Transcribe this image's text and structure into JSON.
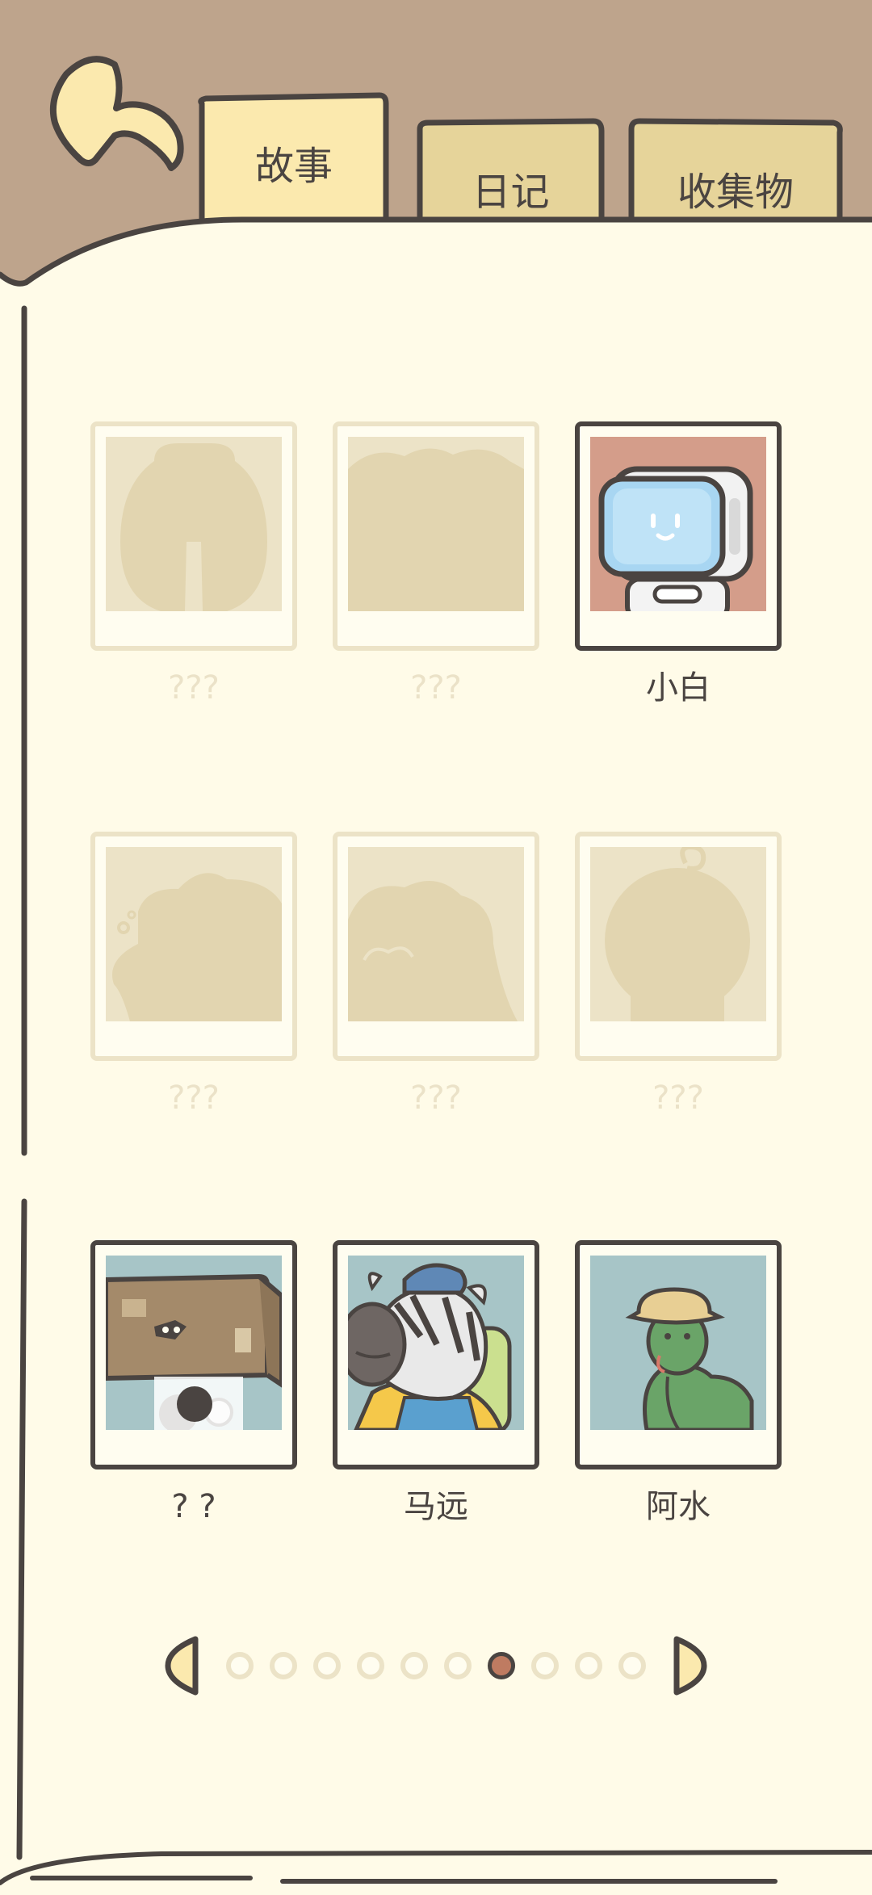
{
  "tabs": [
    {
      "label": "故事",
      "active": true
    },
    {
      "label": "日记",
      "active": false
    },
    {
      "label": "收集物",
      "active": false
    }
  ],
  "characters": [
    {
      "label": "???",
      "unlocked": false,
      "silhouette": "bear"
    },
    {
      "label": "???",
      "unlocked": false,
      "silhouette": "cloud"
    },
    {
      "label": "小白",
      "unlocked": true,
      "portrait": "robot-tv-head",
      "bg": "#d49d8a"
    },
    {
      "label": "???",
      "unlocked": false,
      "silhouette": "cat"
    },
    {
      "label": "???",
      "unlocked": false,
      "silhouette": "curly-hair"
    },
    {
      "label": "???",
      "unlocked": false,
      "silhouette": "round-sprout"
    },
    {
      "label": "? ?",
      "unlocked": true,
      "portrait": "box-head",
      "bg": "#a7c5c7"
    },
    {
      "label": "马远",
      "unlocked": true,
      "portrait": "zebra-helmet",
      "bg": "#a7c5c7"
    },
    {
      "label": "阿水",
      "unlocked": true,
      "portrait": "green-snake-hat",
      "bg": "#a7c5c7"
    }
  ],
  "pagination": {
    "total": 10,
    "current": 7
  },
  "colors": {
    "page": "#fffbe8",
    "frame": "#bea48c",
    "ink": "#4a4441",
    "tab": "#f8e8b2",
    "locked": "#ece3c7",
    "accent": "#bf7b61"
  }
}
